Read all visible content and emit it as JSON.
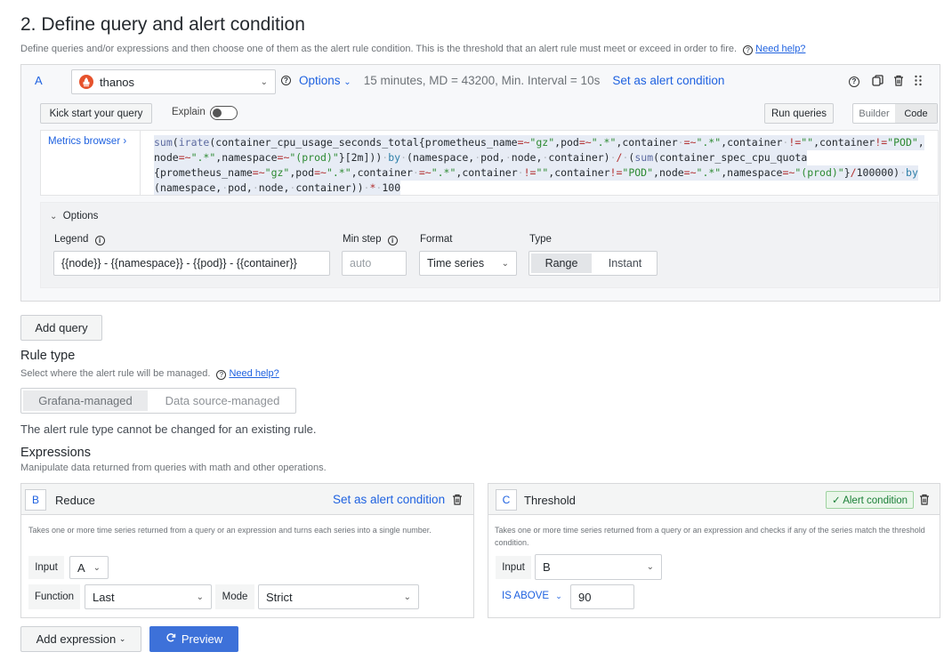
{
  "section": {
    "title": "2. Define query and alert condition",
    "description": "Define queries and/or expressions and then choose one of them as the alert rule condition. This is the threshold that an alert rule must meet or exceed in order to fire.",
    "help_link": "Need help?"
  },
  "query": {
    "ref_id": "A",
    "datasource": "thanos",
    "options_label": "Options",
    "options_summary": "15 minutes, MD = 43200, Min. Interval = 10s",
    "set_alert_condition": "Set as alert condition",
    "kick_start": "Kick start your query",
    "explain": "Explain",
    "run_queries": "Run queries",
    "builder": "Builder",
    "code": "Code",
    "metrics_browser": "Metrics browser ›",
    "expr_line1": "sum(irate(container_cpu_usage_seconds_total{prometheus_name=~\"gz\",pod=~\".*\",container =~\".*\",container !=\"\",container!=\"POD\",",
    "expr_line2": "node=~\".*\",namespace=~\"(prod)\"}[2m])) by (namespace, pod, node, container) / (sum(container_spec_cpu_quota",
    "expr_line3": "{prometheus_name=~\"gz\",pod=~\".*\",container =~\".*\",container !=\"\",container!=\"POD\",node=~\".*\",namespace=~\"(prod)\"}/100000) by",
    "expr_line4": "(namespace, pod, node, container)) * 100",
    "options": {
      "header": "Options",
      "legend_label": "Legend",
      "legend_value": "{{node}} - {{namespace}} - {{pod}} - {{container}}",
      "min_step_label": "Min step",
      "min_step_placeholder": "auto",
      "format_label": "Format",
      "format_value": "Time series",
      "type_label": "Type",
      "type_range": "Range",
      "type_instant": "Instant"
    }
  },
  "add_query": "Add query",
  "rule_type": {
    "title": "Rule type",
    "description": "Select where the alert rule will be managed.",
    "help_link": "Need help?",
    "grafana_managed": "Grafana-managed",
    "datasource_managed": "Data source-managed",
    "note": "The alert rule type cannot be changed for an existing rule."
  },
  "expressions": {
    "title": "Expressions",
    "description": "Manipulate data returned from queries with math and other operations.",
    "reduce": {
      "ref_id": "B",
      "name": "Reduce",
      "set_alert_condition": "Set as alert condition",
      "description": "Takes one or more time series returned from a query or an expression and turns each series into a single number.",
      "input_label": "Input",
      "input_value": "A",
      "function_label": "Function",
      "function_value": "Last",
      "mode_label": "Mode",
      "mode_value": "Strict"
    },
    "threshold": {
      "ref_id": "C",
      "name": "Threshold",
      "alert_condition_badge": "✓ Alert condition",
      "description": "Takes one or more time series returned from a query or an expression and checks if any of the series match the threshold condition.",
      "input_label": "Input",
      "input_value": "B",
      "operator": "IS ABOVE",
      "value": "90"
    }
  },
  "add_expression": "Add expression",
  "preview": "Preview"
}
